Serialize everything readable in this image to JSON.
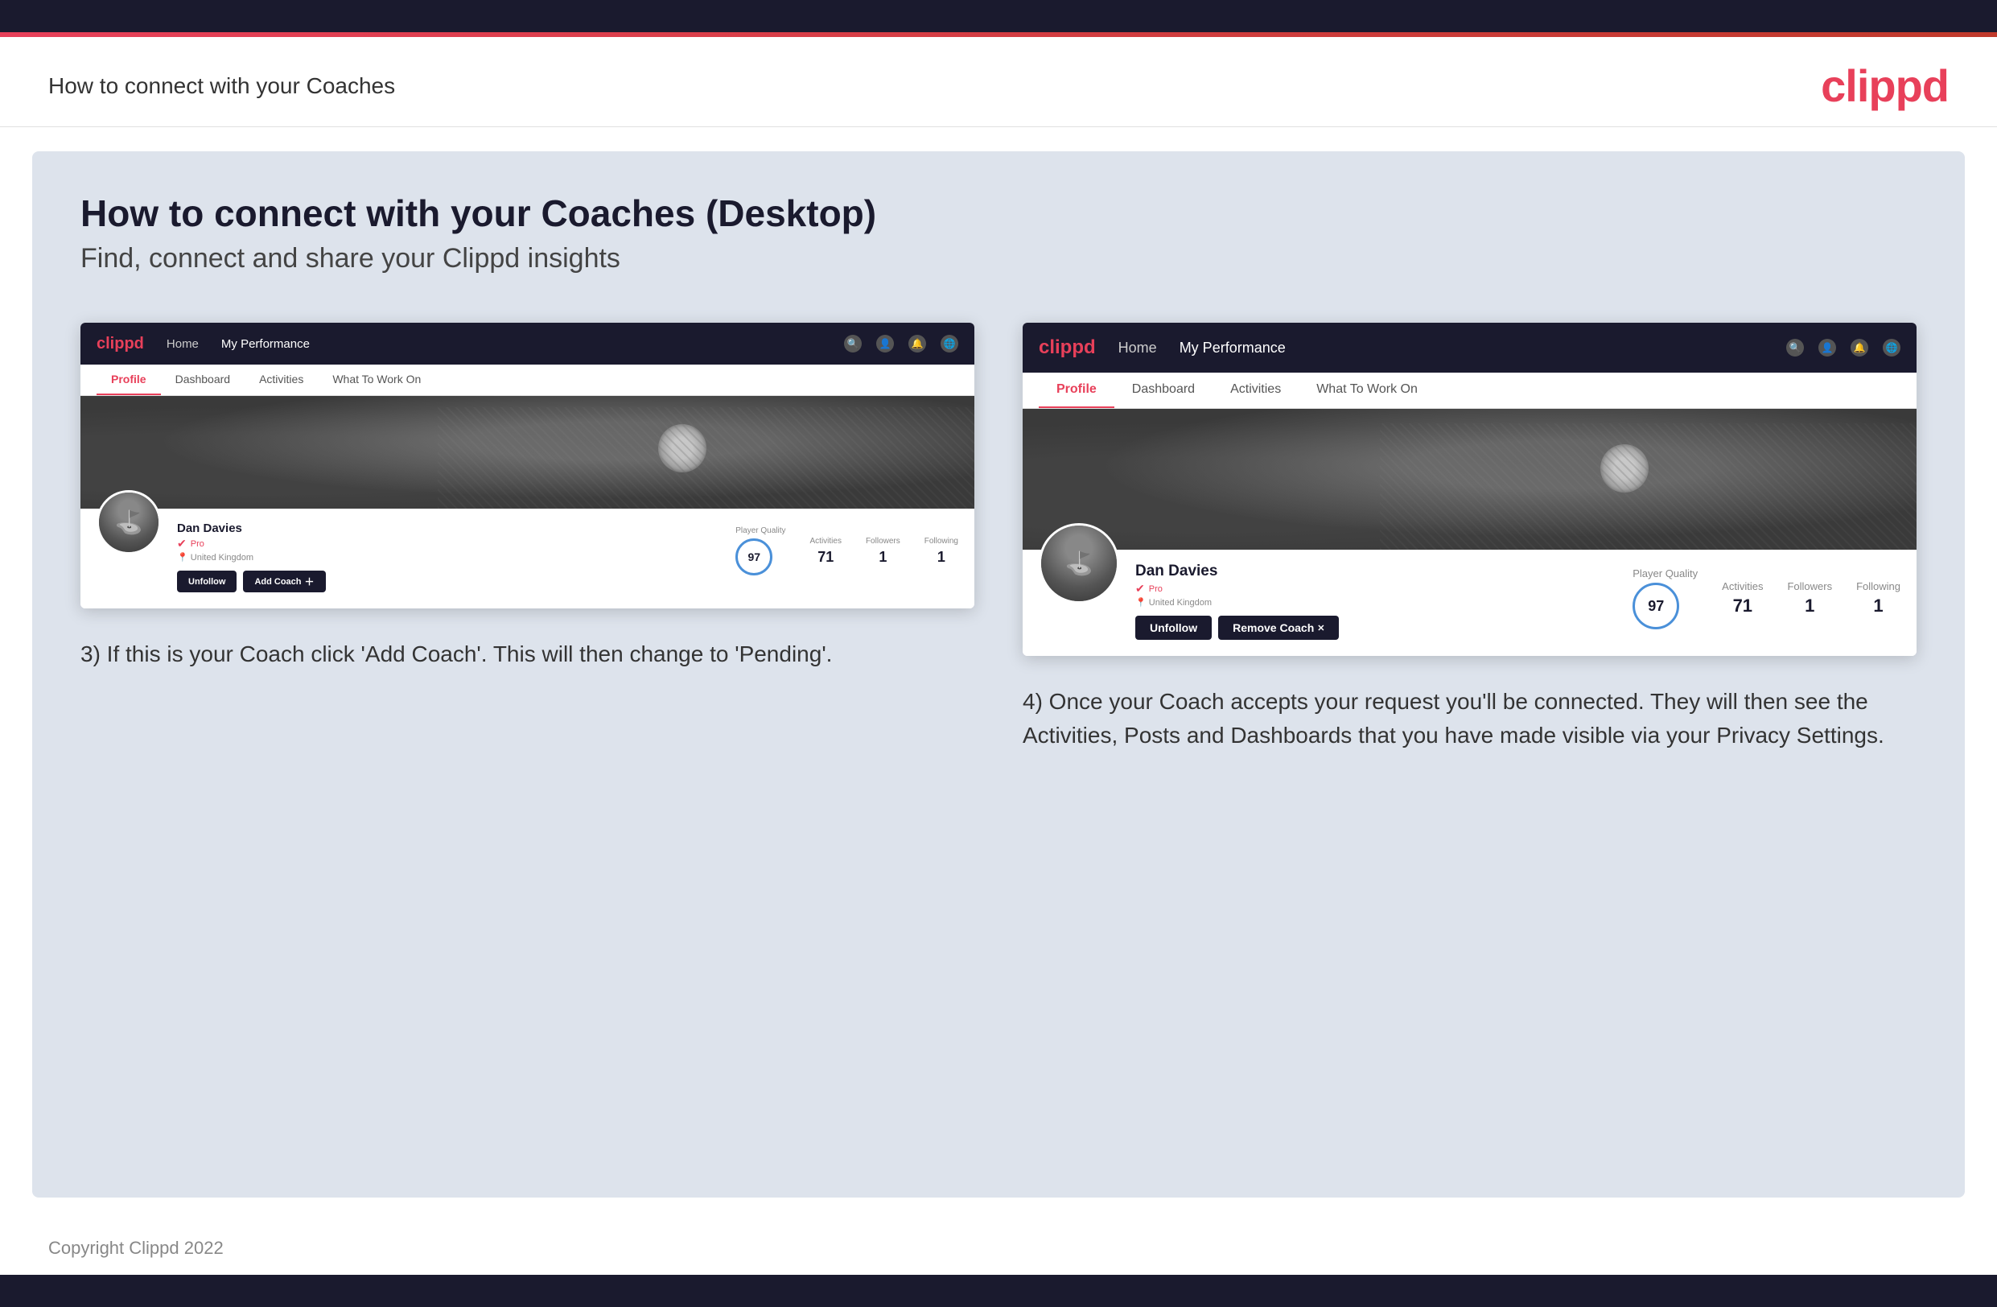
{
  "top_bar": {},
  "header": {
    "title": "How to connect with your Coaches",
    "logo": "clippd"
  },
  "main": {
    "title": "How to connect with your Coaches (Desktop)",
    "subtitle": "Find, connect and share your Clippd insights",
    "card1": {
      "navbar": {
        "logo": "clippd",
        "nav_items": [
          "Home",
          "My Performance"
        ],
        "icons": [
          "search",
          "user",
          "bell",
          "globe"
        ]
      },
      "tabs": [
        "Profile",
        "Dashboard",
        "Activities",
        "What To Work On"
      ],
      "active_tab": "Profile",
      "user": {
        "name": "Dan Davies",
        "badge": "Pro",
        "location": "United Kingdom",
        "player_quality": "97",
        "player_quality_label": "Player Quality",
        "activities": "71",
        "activities_label": "Activities",
        "followers": "1",
        "followers_label": "Followers",
        "following": "1",
        "following_label": "Following"
      },
      "buttons": {
        "unfollow": "Unfollow",
        "add_coach": "Add Coach"
      }
    },
    "card2": {
      "navbar": {
        "logo": "clippd",
        "nav_items": [
          "Home",
          "My Performance"
        ],
        "icons": [
          "search",
          "user",
          "bell",
          "globe"
        ]
      },
      "tabs": [
        "Profile",
        "Dashboard",
        "Activities",
        "What To Work On"
      ],
      "active_tab": "Profile",
      "user": {
        "name": "Dan Davies",
        "badge": "Pro",
        "location": "United Kingdom",
        "player_quality": "97",
        "player_quality_label": "Player Quality",
        "activities": "71",
        "activities_label": "Activities",
        "followers": "1",
        "followers_label": "Followers",
        "following": "1",
        "following_label": "Following"
      },
      "buttons": {
        "unfollow": "Unfollow",
        "remove_coach": "Remove Coach"
      }
    },
    "desc1": "3) If this is your Coach click 'Add Coach'. This will then change to 'Pending'.",
    "desc2": "4) Once your Coach accepts your request you'll be connected. They will then see the Activities, Posts and Dashboards that you have made visible via your Privacy Settings."
  },
  "footer": {
    "copyright": "Copyright Clippd 2022"
  }
}
